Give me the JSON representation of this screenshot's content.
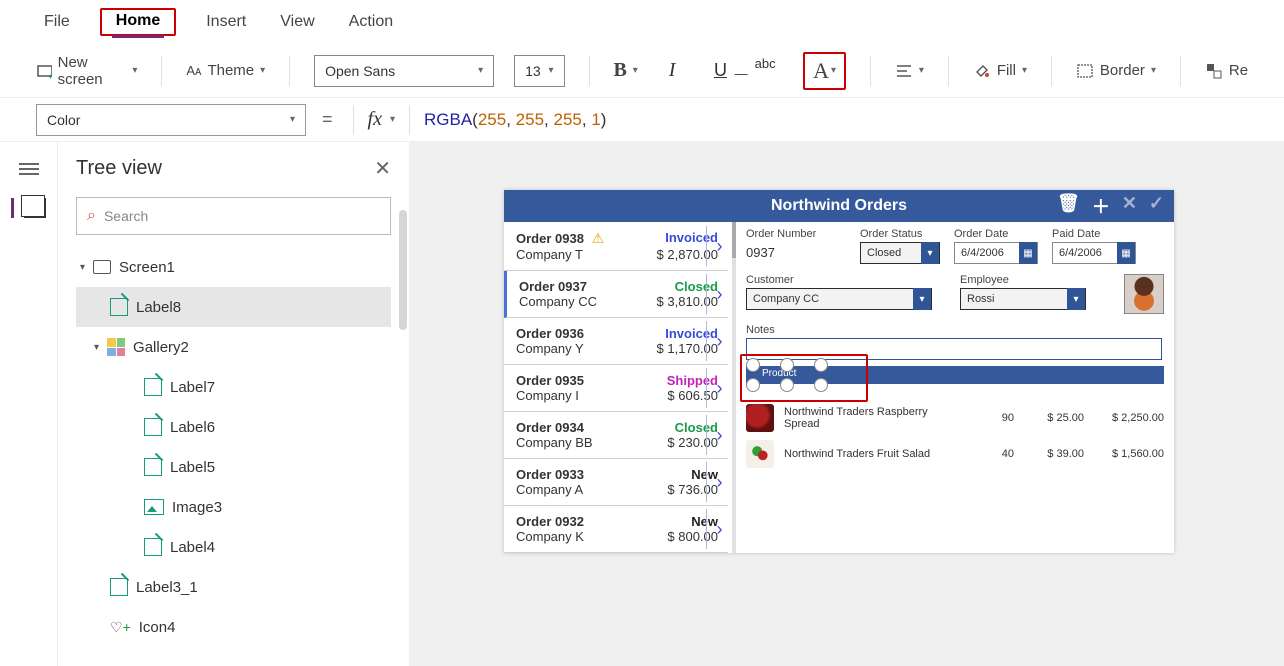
{
  "menu": {
    "file": "File",
    "home": "Home",
    "insert": "Insert",
    "view": "View",
    "action": "Action"
  },
  "ribbon": {
    "new_screen": "New screen",
    "theme": "Theme",
    "font_name": "Open Sans",
    "font_size": "13",
    "fill": "Fill",
    "border": "Border",
    "reorder": "Re"
  },
  "formula": {
    "property": "Color",
    "fn": "RGBA",
    "args": [
      "255",
      "255",
      "255",
      "1"
    ]
  },
  "tree": {
    "title": "Tree view",
    "search_placeholder": "Search",
    "nodes": {
      "screen": "Screen1",
      "label8": "Label8",
      "gallery2": "Gallery2",
      "label7": "Label7",
      "label6": "Label6",
      "label5": "Label5",
      "image3": "Image3",
      "label4": "Label4",
      "label3_1": "Label3_1",
      "icon4": "Icon4"
    }
  },
  "app": {
    "title": "Northwind Orders",
    "orders": [
      {
        "id": "Order 0938",
        "company": "Company T",
        "status": "Invoiced",
        "amount": "$ 2,870.00",
        "warn": true
      },
      {
        "id": "Order 0937",
        "company": "Company CC",
        "status": "Closed",
        "amount": "$ 3,810.00"
      },
      {
        "id": "Order 0936",
        "company": "Company Y",
        "status": "Invoiced",
        "amount": "$ 1,170.00"
      },
      {
        "id": "Order 0935",
        "company": "Company I",
        "status": "Shipped",
        "amount": "$ 606.50"
      },
      {
        "id": "Order 0934",
        "company": "Company BB",
        "status": "Closed",
        "amount": "$ 230.00"
      },
      {
        "id": "Order 0933",
        "company": "Company A",
        "status": "New",
        "amount": "$ 736.00"
      },
      {
        "id": "Order 0932",
        "company": "Company K",
        "status": "New",
        "amount": "$ 800.00"
      }
    ],
    "detail": {
      "labels": {
        "order_number": "Order Number",
        "order_status": "Order Status",
        "order_date": "Order Date",
        "paid_date": "Paid Date",
        "customer": "Customer",
        "employee": "Employee",
        "notes": "Notes",
        "product": "Product"
      },
      "order_number": "0937",
      "order_status": "Closed",
      "order_date": "6/4/2006",
      "paid_date": "6/4/2006",
      "customer": "Company CC",
      "employee": "Rossi"
    },
    "lines": [
      {
        "name": "Northwind Traders Raspberry Spread",
        "qty": "90",
        "price": "$ 25.00",
        "total": "$ 2,250.00"
      },
      {
        "name": "Northwind Traders Fruit Salad",
        "qty": "40",
        "price": "$ 39.00",
        "total": "$ 1,560.00"
      }
    ]
  }
}
